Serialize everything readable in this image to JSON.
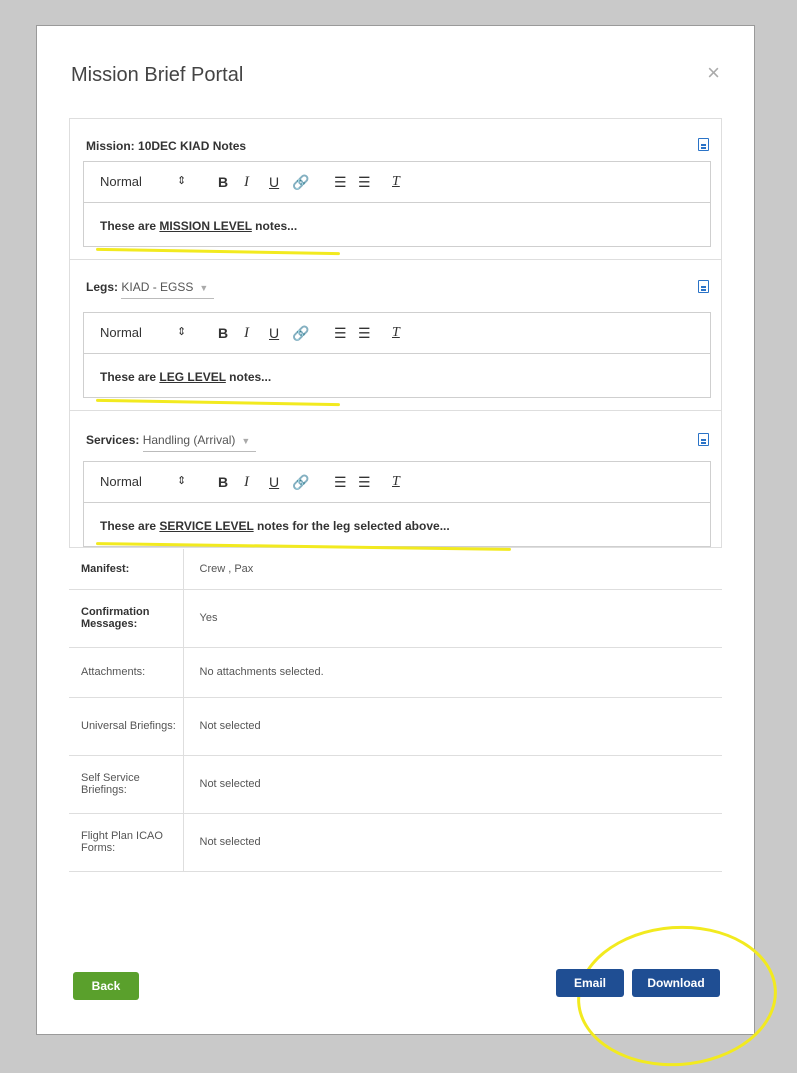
{
  "modal": {
    "title": "Mission Brief Portal",
    "close": "×"
  },
  "mission": {
    "label": "Mission:",
    "name": "10DEC KIAD Notes",
    "note_prefix": "These are ",
    "note_emph": "MISSION LEVEL",
    "note_suffix": " notes..."
  },
  "legs": {
    "label": "Legs:",
    "selected": "KIAD - EGSS",
    "note_prefix": "These are ",
    "note_emph": "LEG LEVEL",
    "note_suffix": " notes..."
  },
  "services": {
    "label": "Services:",
    "selected": "Handling (Arrival)",
    "note_prefix": "These are ",
    "note_emph": "SERVICE LEVEL",
    "note_suffix": " notes for the leg selected above..."
  },
  "toolbar": {
    "format": "Normal",
    "format_arrow": "⇕",
    "bold": "B",
    "italic": "I",
    "underline": "U",
    "link": "🔗",
    "ordered": "☰",
    "bullet": "☰",
    "clear": "T"
  },
  "info": [
    {
      "key": "Manifest:",
      "value": "Crew , Pax"
    },
    {
      "key": "Confirmation Messages:",
      "value": "Yes"
    },
    {
      "key": "Attachments:",
      "value": "No attachments selected."
    },
    {
      "key": "Universal Briefings:",
      "value": "Not selected"
    },
    {
      "key": "Self Service Briefings:",
      "value": "Not selected"
    },
    {
      "key": "Flight Plan ICAO Forms:",
      "value": "Not selected"
    }
  ],
  "buttons": {
    "back": "Back",
    "email": "Email",
    "download": "Download"
  },
  "colors": {
    "primary": "#1f4e93",
    "success": "#5aa02c",
    "highlight": "#f2ea1f",
    "icon": "#2a73c7"
  },
  "icons": {
    "doc": "document-icon",
    "close": "close-icon"
  }
}
